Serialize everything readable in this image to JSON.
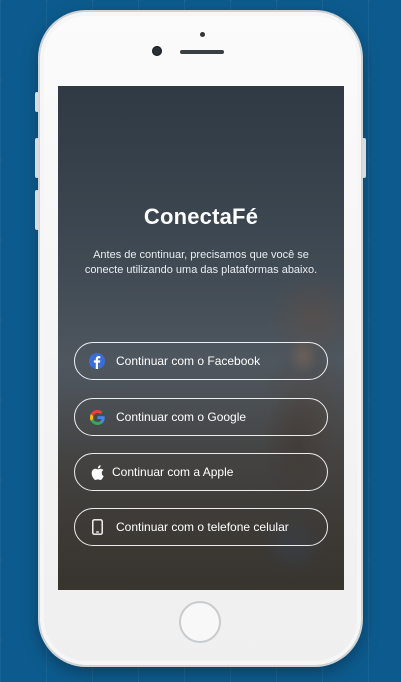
{
  "app": {
    "title": "ConectaFé",
    "subtitle": "Antes de continuar, precisamos que você se conecte utilizando uma das plataformas abaixo."
  },
  "login_options": [
    {
      "label": "Continuar com o Facebook",
      "icon": "facebook-icon"
    },
    {
      "label": "Continuar com o Google",
      "icon": "google-icon"
    },
    {
      "label": "Continuar com a Apple",
      "icon": "apple-icon"
    },
    {
      "label": "Continuar com o telefone celular",
      "icon": "phone-icon"
    }
  ],
  "colors": {
    "background": "#0d5b8e",
    "facebook": "#3b6dd9",
    "google_blue": "#4285f4",
    "google_red": "#ea4335",
    "google_yellow": "#fbbc05",
    "google_green": "#34a853"
  }
}
